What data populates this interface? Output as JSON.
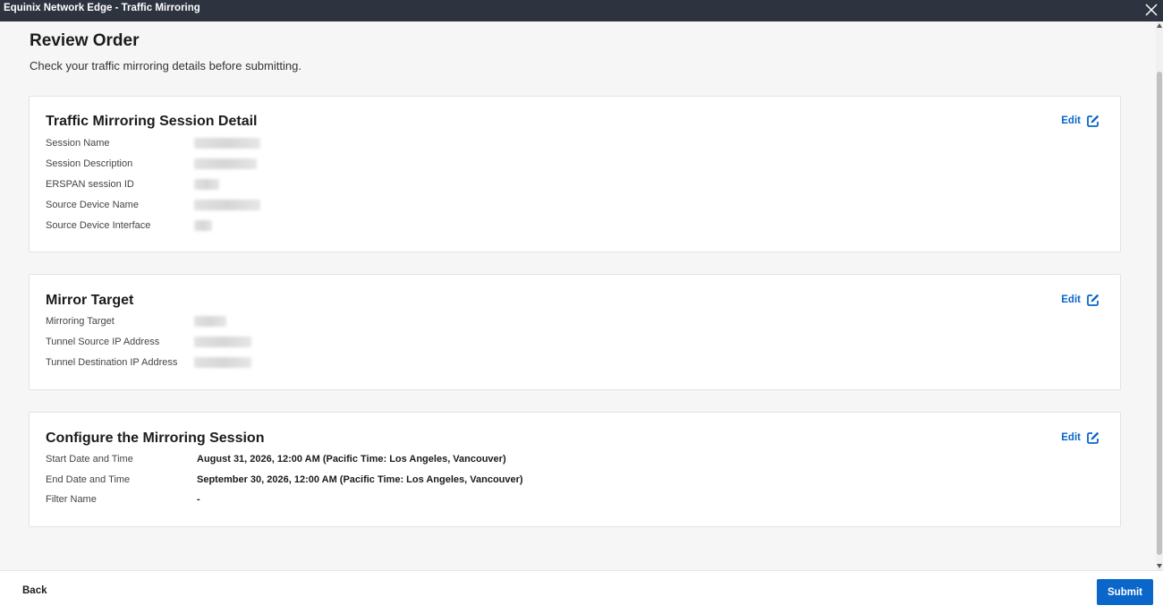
{
  "window": {
    "title": "Equinix Network Edge - Traffic Mirroring",
    "close_icon": "close-icon"
  },
  "header": {
    "title": "Review Order",
    "subtitle": "Check your traffic mirroring details before submitting."
  },
  "edit_label": "Edit",
  "sections": {
    "session_detail": {
      "title": "Traffic Mirroring Session Detail",
      "rows": [
        {
          "label": "Session Name",
          "value": ""
        },
        {
          "label": "Session Description",
          "value": ""
        },
        {
          "label": "ERSPAN session ID",
          "value": ""
        },
        {
          "label": "Source Device Name",
          "value": ""
        },
        {
          "label": "Source Device Interface",
          "value": ""
        }
      ]
    },
    "mirror_target": {
      "title": "Mirror Target",
      "rows": [
        {
          "label": "Mirroring Target",
          "value": ""
        },
        {
          "label": "Tunnel Source IP Address",
          "value": ""
        },
        {
          "label": "Tunnel Destination IP Address",
          "value": ""
        }
      ]
    },
    "configure": {
      "title": "Configure the Mirroring Session",
      "rows": [
        {
          "label": "Start Date and Time",
          "value": "August 31, 2026, 12:00 AM (Pacific Time: Los Angeles, Vancouver)"
        },
        {
          "label": "End Date and Time",
          "value": "September 30, 2026, 12:00 AM (Pacific Time: Los Angeles, Vancouver)"
        },
        {
          "label": "Filter Name",
          "value": "-"
        }
      ]
    }
  },
  "footer": {
    "back_label": "Back",
    "submit_label": "Submit"
  },
  "colors": {
    "accent": "#0a66c9",
    "titlebar": "#2d3440",
    "background": "#f6f6f6"
  }
}
